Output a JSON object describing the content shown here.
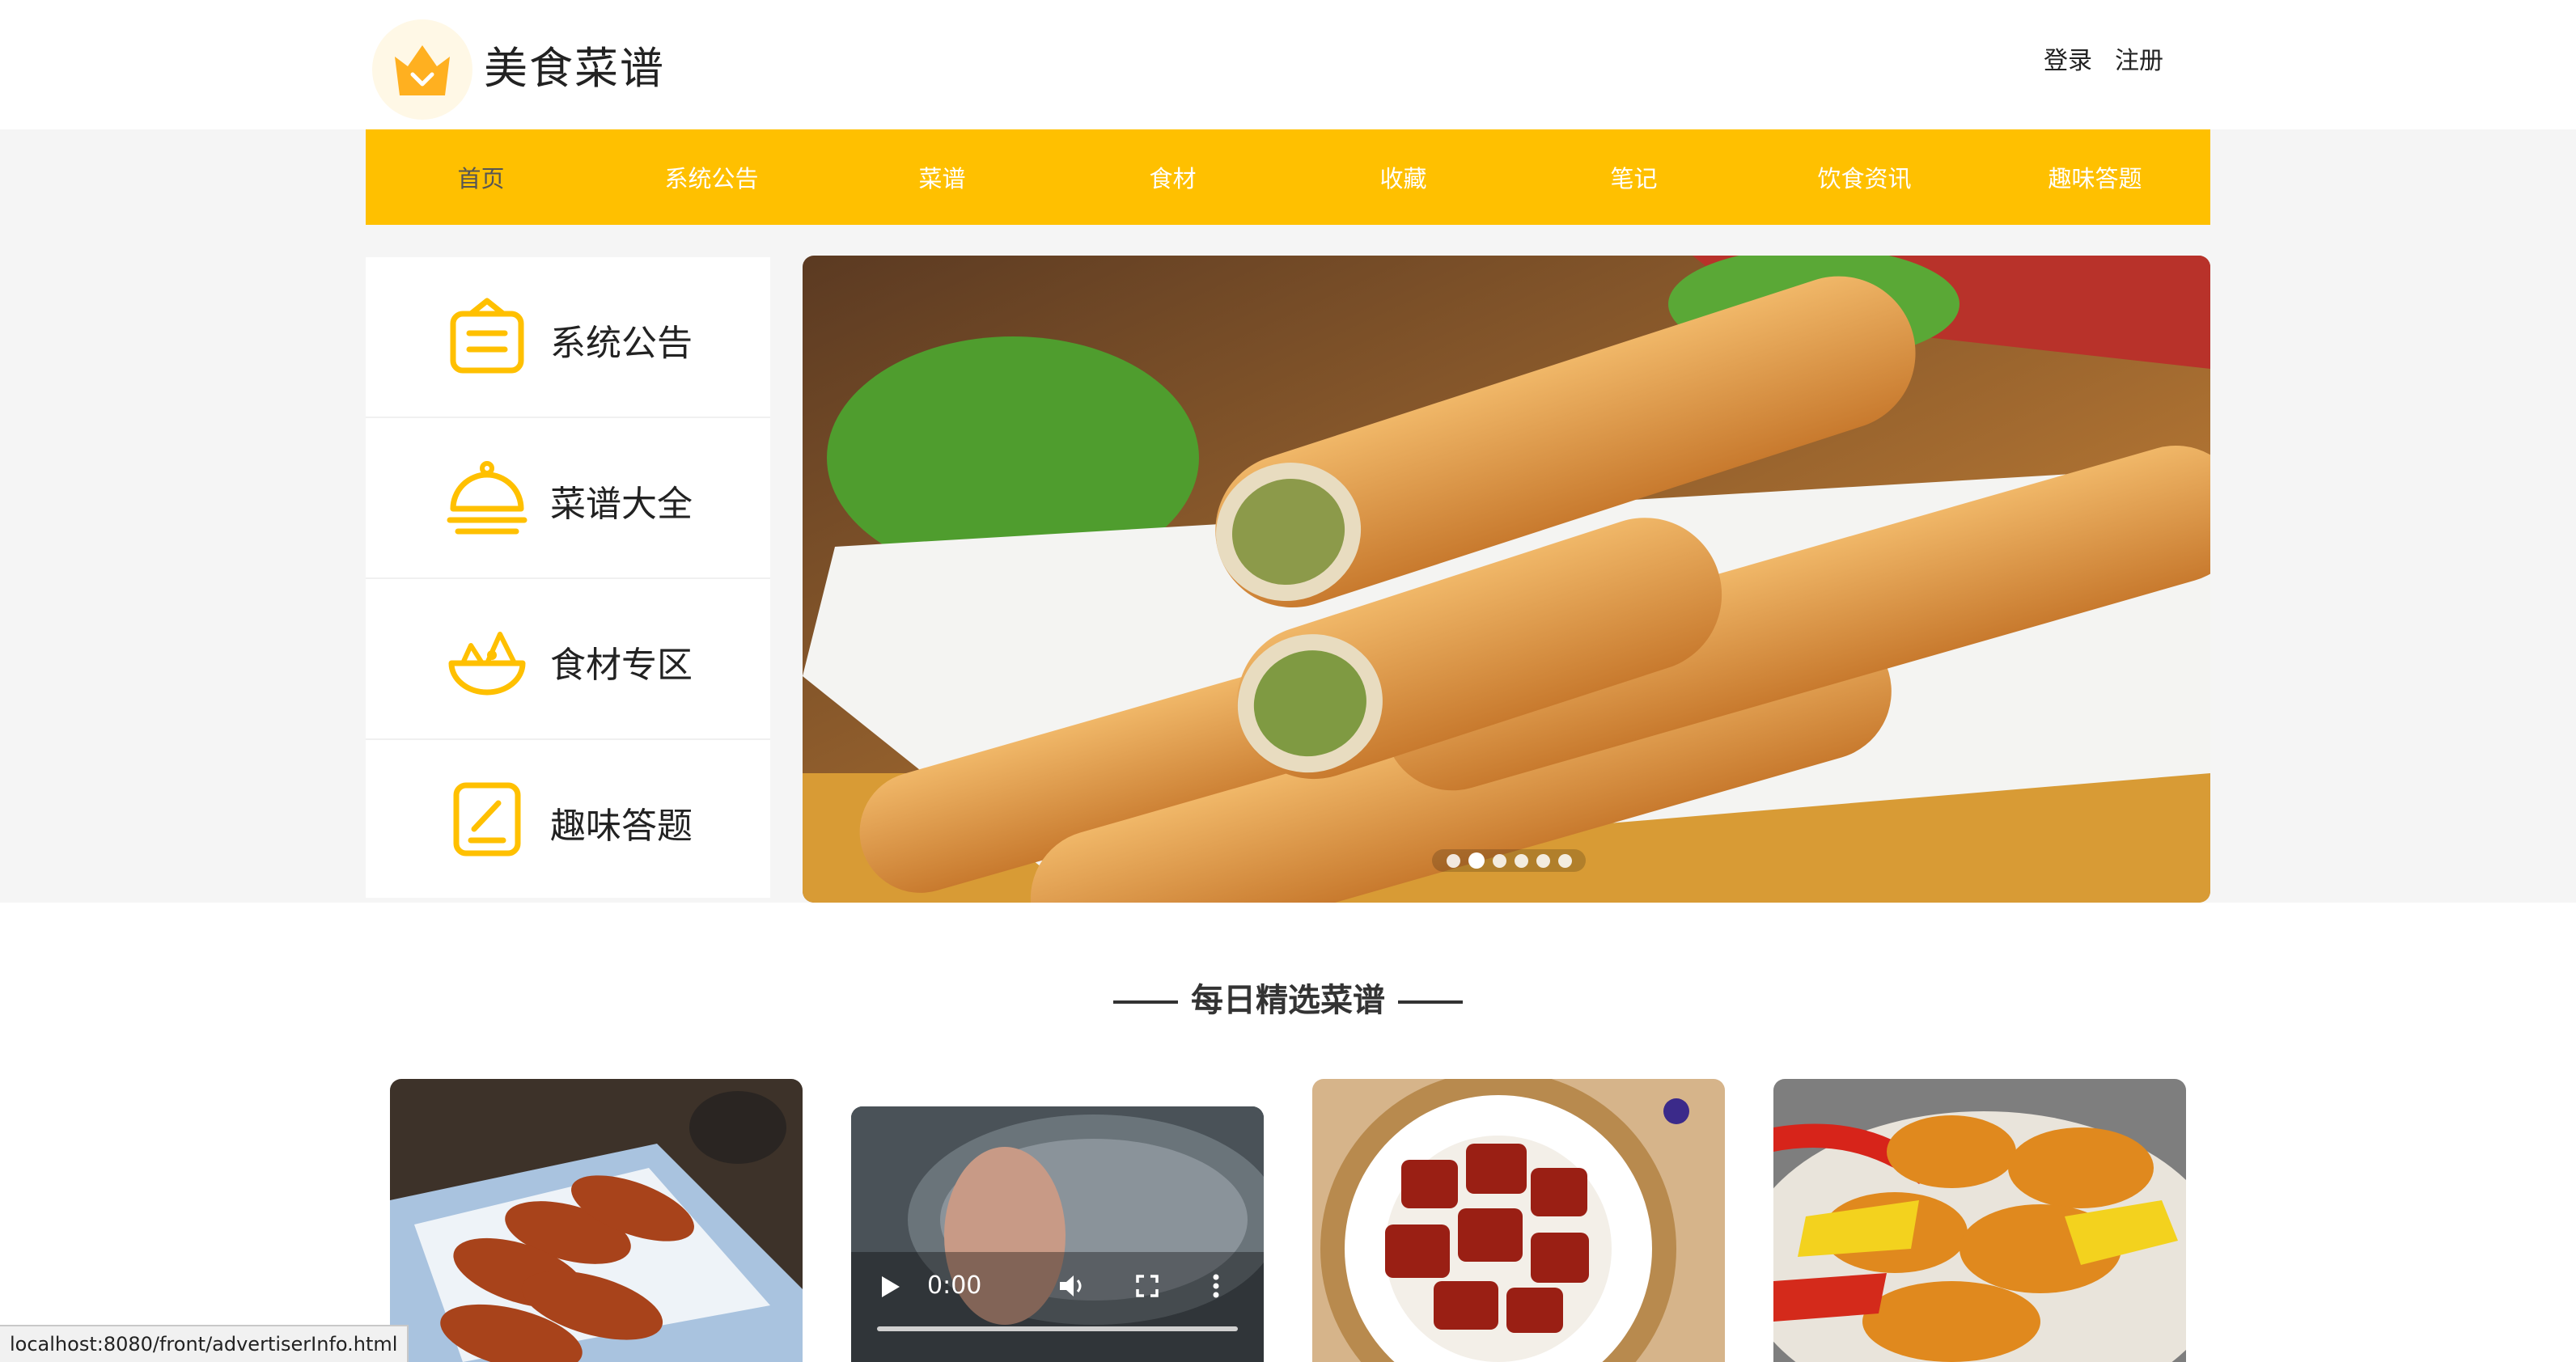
{
  "header": {
    "site_title": "美食菜谱",
    "login_label": "登录",
    "register_label": "注册",
    "logo_icon": "crown-icon"
  },
  "nav": {
    "items": [
      "首页",
      "系统公告",
      "菜谱",
      "食材",
      "收藏",
      "笔记",
      "饮食资讯",
      "趣味答题"
    ],
    "active_index": 0
  },
  "side_menu": {
    "items": [
      {
        "label": "系统公告",
        "icon": "notice-board-icon"
      },
      {
        "label": "菜谱大全",
        "icon": "food-cloche-icon"
      },
      {
        "label": "食材专区",
        "icon": "salad-bowl-icon"
      },
      {
        "label": "趣味答题",
        "icon": "quiz-pencil-icon"
      }
    ]
  },
  "banner": {
    "image": "spring-rolls-photo",
    "slide_count": 6,
    "active_slide": 2
  },
  "featured": {
    "title": "每日精选菜谱",
    "cards": [
      {
        "image": "braised-chicken-wings-photo"
      },
      {
        "image": "cooking-video",
        "video_time": "0:00"
      },
      {
        "image": "braised-pork-belly-photo"
      },
      {
        "image": "sweet-sour-pork-photo"
      }
    ]
  },
  "status_bar": {
    "url": "localhost:8080/front/advertiserInfo.html"
  },
  "colors": {
    "accent": "#ffc000",
    "band_bg": "#f5f5f5",
    "text": "#222222"
  }
}
